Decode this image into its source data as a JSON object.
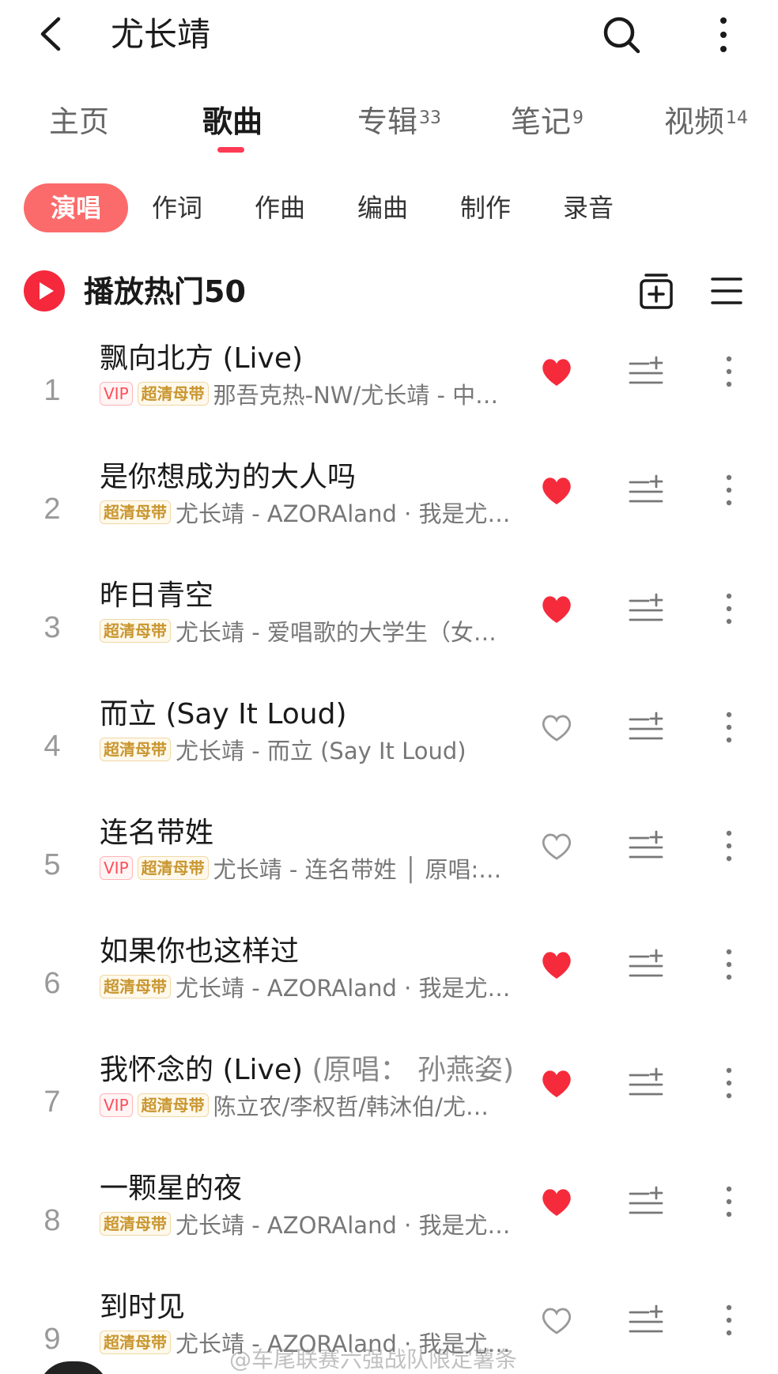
{
  "header": {
    "title": "尤长靖"
  },
  "tabs": [
    {
      "label": "主页",
      "count": ""
    },
    {
      "label": "歌曲",
      "count": "",
      "active": true
    },
    {
      "label": "专辑",
      "count": "33"
    },
    {
      "label": "笔记",
      "count": "9"
    },
    {
      "label": "视频",
      "count": "14"
    }
  ],
  "roles": [
    {
      "label": "演唱",
      "active": true
    },
    {
      "label": "作词"
    },
    {
      "label": "作曲"
    },
    {
      "label": "编曲"
    },
    {
      "label": "制作"
    },
    {
      "label": "录音"
    }
  ],
  "play": {
    "label": "播放热门50"
  },
  "badges": {
    "vip": "VIP",
    "hq": "超清母带"
  },
  "songs": [
    {
      "index": "1",
      "title": "飘向北方 (Live)",
      "orig": "",
      "vip": true,
      "hq": true,
      "meta": "那吾克热-NW/尤长靖 - 中…",
      "liked": true
    },
    {
      "index": "2",
      "title": "是你想成为的大人吗",
      "orig": "",
      "vip": false,
      "hq": true,
      "meta": "尤长靖 - AZORAland · 我是尤…",
      "liked": true
    },
    {
      "index": "3",
      "title": "昨日青空",
      "orig": "",
      "vip": false,
      "hq": true,
      "meta": "尤长靖 - 爱唱歌的大学生（女…",
      "liked": true
    },
    {
      "index": "4",
      "title": "而立 (Say It Loud)",
      "orig": "",
      "vip": false,
      "hq": true,
      "meta": "尤长靖 - 而立 (Say It Loud)",
      "liked": false
    },
    {
      "index": "5",
      "title": "连名带姓",
      "orig": "",
      "vip": true,
      "hq": true,
      "meta": "尤长靖 - 连名带姓 │ 原唱:…",
      "liked": false
    },
    {
      "index": "6",
      "title": "如果你也这样过",
      "orig": "",
      "vip": false,
      "hq": true,
      "meta": "尤长靖 - AZORAland · 我是尤…",
      "liked": true
    },
    {
      "index": "7",
      "title": "我怀念的 (Live)",
      "orig": "(原唱： 孙燕姿)",
      "vip": true,
      "hq": true,
      "meta": "陈立农/李权哲/韩沐伯/尤…",
      "liked": true
    },
    {
      "index": "8",
      "title": "一颗星的夜",
      "orig": "",
      "vip": false,
      "hq": true,
      "meta": "尤长靖 - AZORAland · 我是尤…",
      "liked": true
    },
    {
      "index": "9",
      "title": "到时见",
      "orig": "",
      "vip": false,
      "hq": true,
      "meta": "尤长靖 - AZORAland · 我是尤…",
      "liked": false
    }
  ],
  "watermark": "@车尾联赛六强战队限定薯条",
  "colors": {
    "accent": "#ff3a55",
    "chip": "#fb6b6b",
    "heart": "#f52b3c"
  }
}
